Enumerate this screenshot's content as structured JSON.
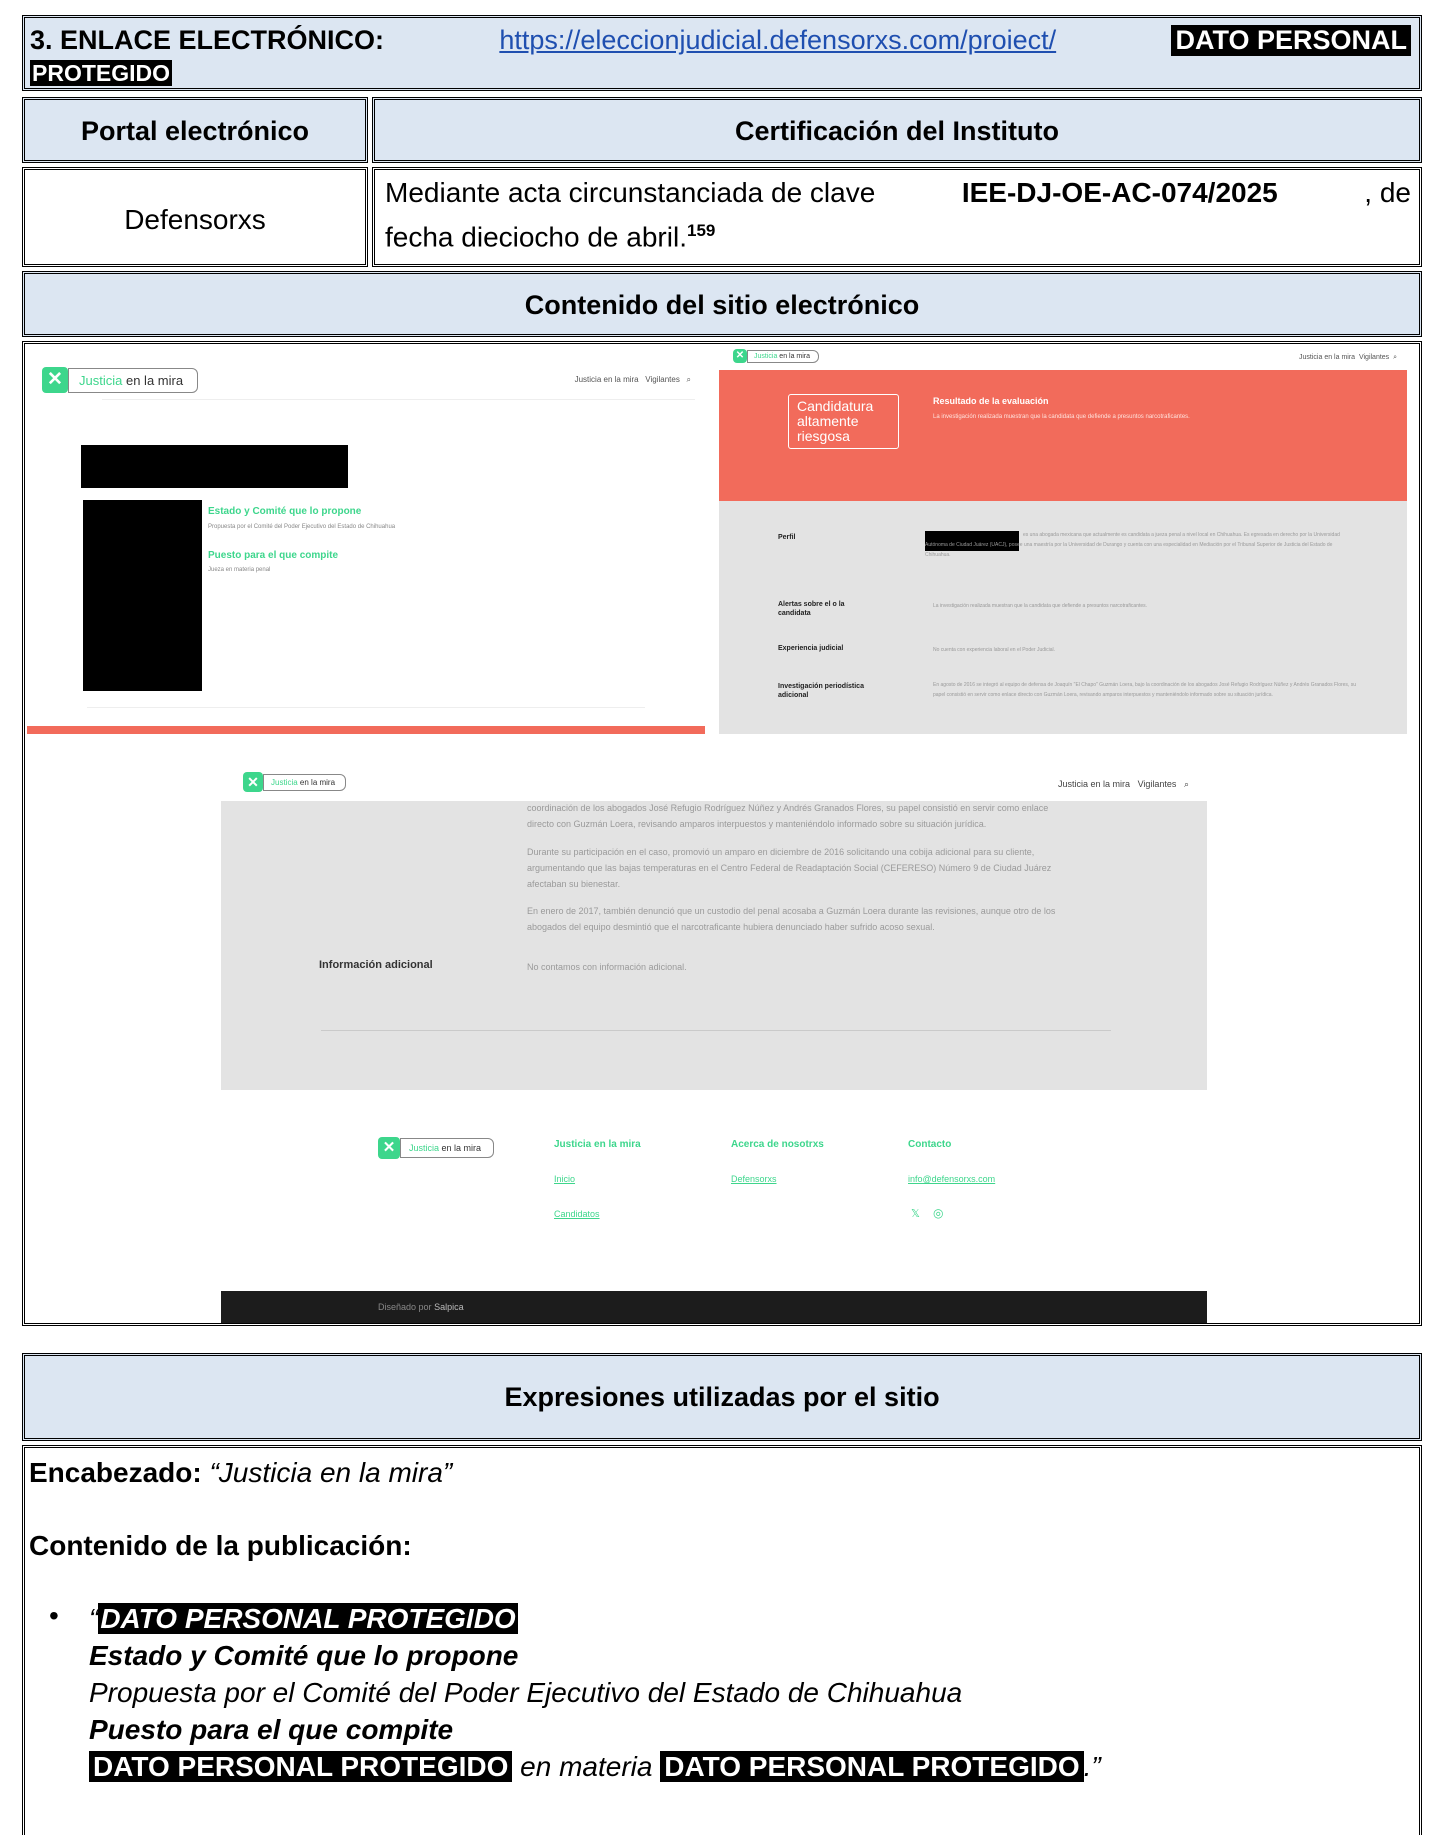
{
  "header": {
    "title": "3. ENLACE ELECTRÓNICO:",
    "url": "https://eleccionjudicial.defensorxs.com/proiect/",
    "redacted_a": "DATO PERSONAL",
    "redacted_b": "PROTEGIDO"
  },
  "table": {
    "col1_header": "Portal electrónico",
    "col2_header": "Certificación del Instituto",
    "portal": "Defensorxs",
    "cert_prefix": "Mediante acta circunstanciada de clave ",
    "cert_code": "IEE-DJ-OE-AC-074/2025",
    "cert_mid": ", de",
    "cert_line2": "fecha dieciocho de abril.",
    "footnote": "159"
  },
  "content_header": "Contenido del sitio electrónico",
  "screens": {
    "logo_a": "Justicia",
    "logo_b": "en la mira",
    "nav_a": "Justicia en la mira",
    "nav_b": "Vigilantes",
    "s1": {
      "label_estado": "Estado y Comité que lo propone",
      "val_estado": "Propuesta por el Comité del Poder Ejecutivo del Estado de Chihuahua",
      "label_puesto": "Puesto para el que compite",
      "val_puesto": "Jueza en materia penal"
    },
    "s2": {
      "badge": [
        "Candidatura",
        "altamente",
        "riesgosa"
      ],
      "result_title": "Resultado de la evaluación",
      "result_text": "La investigación realizada muestran que la candidata que defiende a presuntos narcotraficantes.",
      "perfil": "Perfil",
      "perfil_text": "es una abogada mexicana que actualmente es candidata a jueza penal a nivel local en Chihuahua. Es egresada en derecho por la Universidad Autónoma de Ciudad Juárez (UACJ), posee una maestría por la Universidad de Durango y cuenta con una especialidad en Mediación por el Tribunal Superior de Justicia del Estado de Chihuahua.",
      "alertas": [
        "Alertas sobre el o la",
        "candidata"
      ],
      "alertas_text": "La investigación realizada muestran que la candidata que defiende a presuntos narcotraficantes.",
      "experiencia": "Experiencia judicial",
      "experiencia_text": "No cuenta con experiencia laboral en el Poder Judicial.",
      "investigacion": [
        "Investigación periodística",
        "adicional"
      ],
      "investigacion_text": "En agosto de 2016 se integró al equipo de defensa de Joaquín \"El Chapo\" Guzmán Loera, bajo la coordinación de los abogados José Refugio Rodríguez Núñez y Andrés Granados Flores, su papel consistió en servir como enlace directo con Guzmán Loera, revisando amparos interpuestos y manteniéndolo informado sobre su situación jurídica."
    },
    "s3": {
      "partial_label": "adicional",
      "p1": [
        "coordinación de los abogados José Refugio Rodríguez Núñez y Andrés Granados Flores, su papel consistió en servir como enlace",
        "directo con Guzmán Loera, revisando amparos interpuestos y manteniéndolo informado sobre su situación jurídica."
      ],
      "p2": [
        "Durante su participación en el caso, promovió un amparo en diciembre de 2016 solicitando una cobija adicional para su cliente,",
        "argumentando que las bajas temperaturas en el Centro Federal de Readaptación Social (CEFERESO) Número 9 de Ciudad Juárez",
        "afectaban su bienestar."
      ],
      "p3": [
        "En enero de 2017, también denunció que un custodio del penal acosaba a Guzmán Loera durante las revisiones, aunque otro de los",
        "abogados del equipo desmintió que el narcotraficante hubiera denunciado haber sufrido acoso sexual."
      ],
      "info_label": "Información adicional",
      "info_text": "No contamos con información adicional.",
      "footer_col1": "Justicia en la mira",
      "footer_col2": "Acerca de nosotrxs",
      "footer_col3": "Contacto",
      "link_inicio": "Inicio",
      "link_candidatos": "Candidatos",
      "link_defensorxs": "Defensorxs",
      "link_email": "info@defensorxs.com",
      "social_x": "𝕏",
      "social_ig": "◎",
      "credit_a": "Diseñado por",
      "credit_b": "Salpica"
    }
  },
  "expressions_header": "Expresiones utilizadas por el sitio",
  "expressions": {
    "encabezado_label": "Encabezado:",
    "encabezado_value": "“Justicia en la mira”",
    "contenido_label": "Contenido de la publicación:",
    "bullet": "•",
    "open_quote": "“",
    "redacted": "DATO PERSONAL PROTEGIDO",
    "l2": "Estado y Comité que lo propone",
    "l3": "Propuesta por el Comité del Poder Ejecutivo del Estado de Chihuahua",
    "l4": "Puesto para el que compite",
    "redacted2": "DATO PERSONAL PROTEGIDO",
    "en_materia": " en materia ",
    "redacted3": "DATO PERSONAL PROTEGIDO",
    "close": ".”"
  },
  "colors": {
    "header_bg": "#dce6f2",
    "brand_green": "#3dd68c",
    "alert_coral": "#f26b5b",
    "panel_gray": "#e3e3e3",
    "footer_dark": "#1c1c1c"
  }
}
